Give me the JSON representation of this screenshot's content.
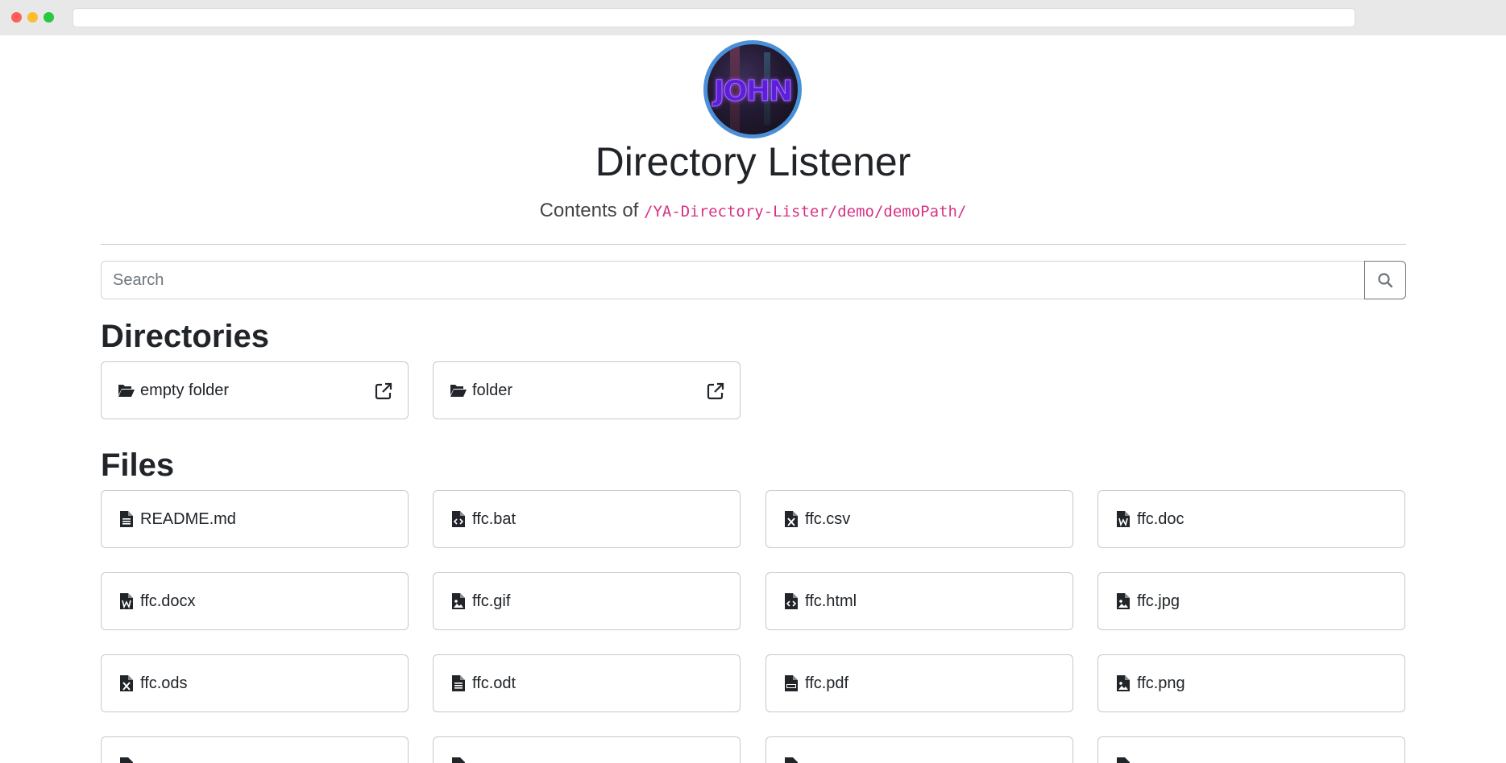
{
  "window": {
    "address": ""
  },
  "header": {
    "avatar_text": "JOHN",
    "title": "Directory Listener",
    "subtitle_prefix": "Contents of",
    "path": "/YA-Directory-Lister/demo/demoPath/"
  },
  "search": {
    "placeholder": "Search",
    "value": "",
    "button_icon": "search-icon"
  },
  "directories": {
    "heading": "Directories",
    "items": [
      {
        "name": "empty folder",
        "icon": "folder-open-icon",
        "action_icon": "external-link-icon"
      },
      {
        "name": "folder",
        "icon": "folder-open-icon",
        "action_icon": "external-link-icon"
      }
    ]
  },
  "files": {
    "heading": "Files",
    "items": [
      {
        "name": "README.md",
        "icon": "file-text-icon"
      },
      {
        "name": "ffc.bat",
        "icon": "file-code-icon"
      },
      {
        "name": "ffc.csv",
        "icon": "file-excel-icon"
      },
      {
        "name": "ffc.doc",
        "icon": "file-word-icon"
      },
      {
        "name": "ffc.docx",
        "icon": "file-word-icon"
      },
      {
        "name": "ffc.gif",
        "icon": "file-image-icon"
      },
      {
        "name": "ffc.html",
        "icon": "file-code-icon"
      },
      {
        "name": "ffc.jpg",
        "icon": "file-image-icon"
      },
      {
        "name": "ffc.ods",
        "icon": "file-excel-icon"
      },
      {
        "name": "ffc.odt",
        "icon": "file-text-icon"
      },
      {
        "name": "ffc.pdf",
        "icon": "file-pdf-icon"
      },
      {
        "name": "ffc.png",
        "icon": "file-image-icon"
      },
      {
        "name": "",
        "icon": "file-icon"
      },
      {
        "name": "",
        "icon": "file-icon"
      },
      {
        "name": "",
        "icon": "file-icon"
      },
      {
        "name": "",
        "icon": "file-icon"
      }
    ]
  },
  "colors": {
    "path": "#d63384",
    "avatar_border": "#4a90d9",
    "card_border": "#c9c9c9",
    "text": "#212529"
  }
}
